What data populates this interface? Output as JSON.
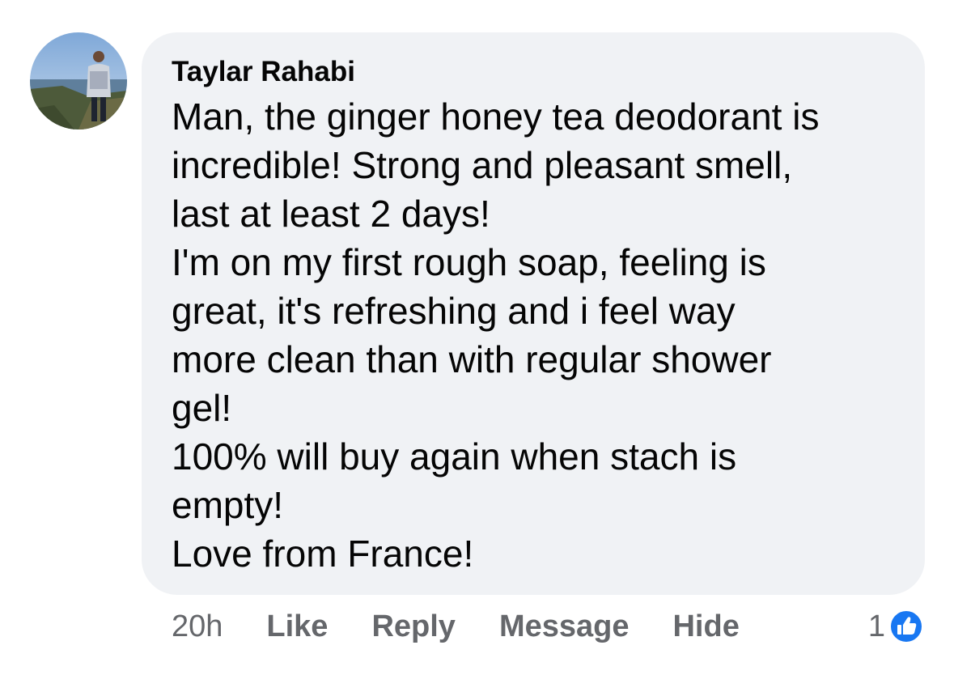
{
  "comment": {
    "author": "Taylar Rahabi",
    "lines": [
      "Man, the ginger honey tea deodorant is",
      "incredible! Strong and pleasant smell,",
      "last at least 2 days!",
      "I'm on my first rough soap, feeling is",
      "great, it's refreshing and i feel way",
      "more clean than with regular shower",
      "gel!",
      "100% will buy again when stach is",
      "empty!",
      "Love from France!"
    ],
    "avatar_icon": "user-photo-avatar"
  },
  "actions": {
    "time": "20h",
    "like_label": "Like",
    "reply_label": "Reply",
    "message_label": "Message",
    "hide_label": "Hide"
  },
  "reactions": {
    "count": "1",
    "icon": "thumbs-up-icon",
    "icon_color": "#1877f2"
  },
  "colors": {
    "bubble": "#f0f2f5",
    "text": "#050505",
    "secondary": "#65676b"
  }
}
